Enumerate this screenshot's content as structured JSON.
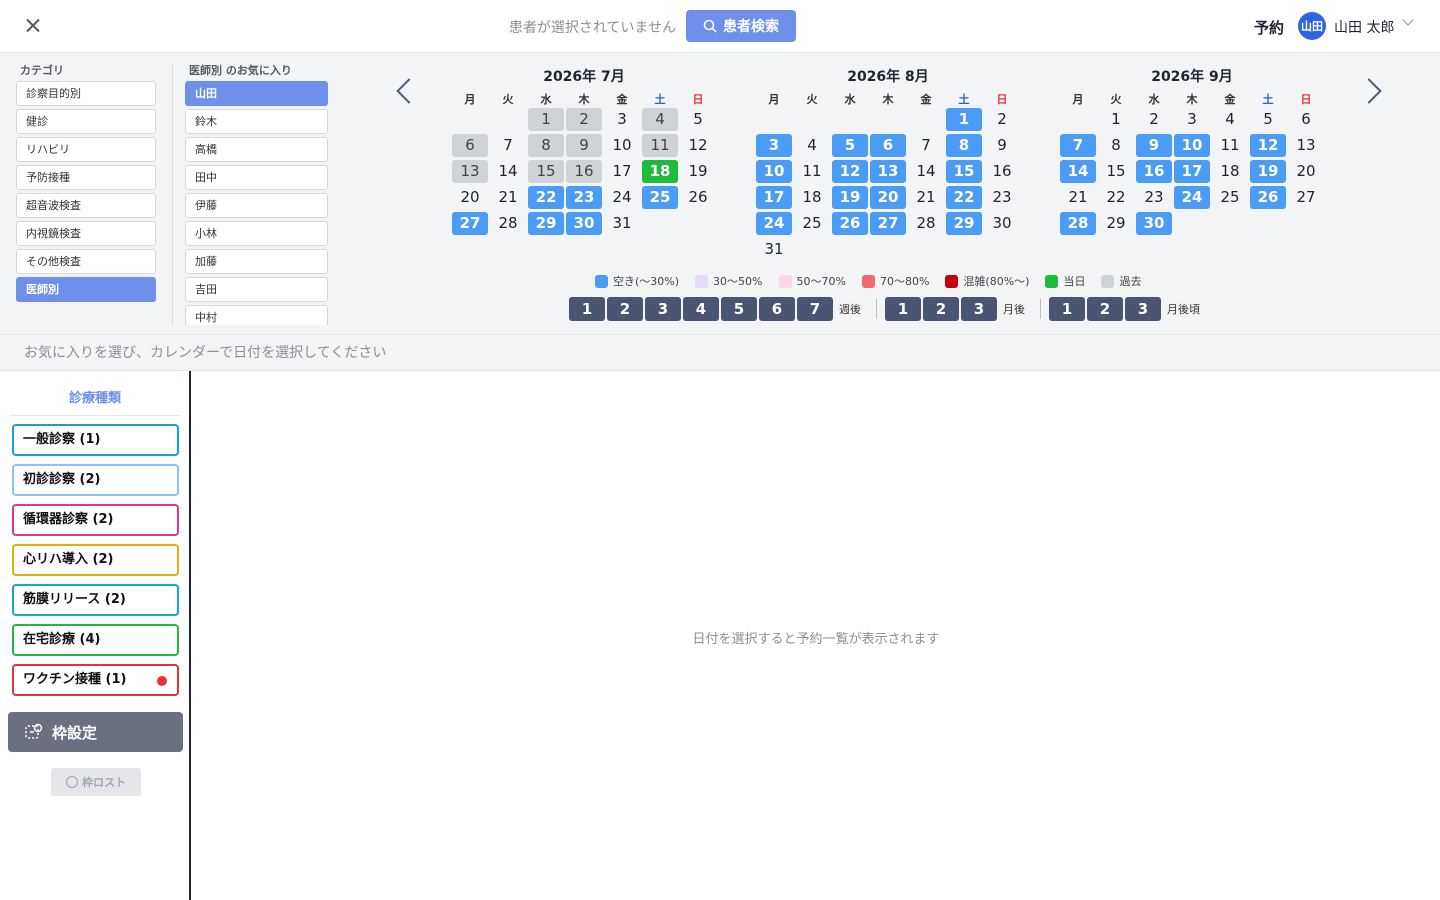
{
  "header": {
    "no_patient_text": "患者が選択されていません",
    "search_button": "患者検索",
    "reservation_label": "予約",
    "avatar_text": "山田",
    "user_name": "山田 太郎"
  },
  "category": {
    "title": "カテゴリ",
    "items": [
      "診察目的別",
      "健診",
      "リハビリ",
      "予防接種",
      "超音波検査",
      "内視鏡検査",
      "その他検査",
      "医師別"
    ],
    "selected_index": 7
  },
  "favorites": {
    "title": "医師別 のお気に入り",
    "items": [
      "山田",
      "鈴木",
      "高橋",
      "田中",
      "伊藤",
      "小林",
      "加藤",
      "吉田",
      "中村"
    ],
    "selected_index": 0
  },
  "weekdays": [
    "月",
    "火",
    "水",
    "木",
    "金",
    "土",
    "日"
  ],
  "months": [
    {
      "title": "2026年 7月",
      "first_weekday": 2,
      "days": 31,
      "past": [
        1,
        2,
        4,
        6,
        8,
        9,
        11,
        13,
        15,
        16
      ],
      "available": [
        22,
        23,
        25,
        27,
        29,
        30
      ],
      "today": 18
    },
    {
      "title": "2026年 8月",
      "first_weekday": 5,
      "days": 31,
      "past": [],
      "available": [
        1,
        3,
        5,
        6,
        8,
        10,
        12,
        13,
        15,
        17,
        19,
        20,
        22,
        24,
        26,
        27,
        29
      ],
      "today": null
    },
    {
      "title": "2026年 9月",
      "first_weekday": 1,
      "days": 30,
      "past": [],
      "available": [
        7,
        9,
        10,
        12,
        14,
        16,
        17,
        19,
        24,
        26,
        28,
        30
      ],
      "today": null
    }
  ],
  "legend": [
    {
      "label": "空き(〜30%)",
      "color": "#4a9cf5"
    },
    {
      "label": "30〜50%",
      "color": "#e6d9fb"
    },
    {
      "label": "50〜70%",
      "color": "#fbd5e8"
    },
    {
      "label": "70〜80%",
      "color": "#f46a6a"
    },
    {
      "label": "混雑(80%〜)",
      "color": "#c40010"
    },
    {
      "label": "当日",
      "color": "#1dba3c"
    },
    {
      "label": "過去",
      "color": "#cfd2d7"
    }
  ],
  "jump_groups": [
    {
      "numbers": [
        "1",
        "2",
        "3",
        "4",
        "5",
        "6",
        "7"
      ],
      "label": "週後"
    },
    {
      "numbers": [
        "1",
        "2",
        "3"
      ],
      "label": "月後"
    },
    {
      "numbers": [
        "1",
        "2",
        "3"
      ],
      "label": "月後頃"
    }
  ],
  "hint_text": "お気に入りを選び、カレンダーで日付を選択してください",
  "types": {
    "title": "診療種類",
    "items": [
      {
        "label": "一般診察 (1)",
        "color": "#1a9fd6",
        "dot": false
      },
      {
        "label": "初診診察 (2)",
        "color": "#8cc2f5",
        "dot": false
      },
      {
        "label": "循環器診察 (2)",
        "color": "#e0368f",
        "dot": false
      },
      {
        "label": "心リハ導入 (2)",
        "color": "#e6ad12",
        "dot": false
      },
      {
        "label": "筋膜リリース (2)",
        "color": "#18a8c0",
        "dot": false
      },
      {
        "label": "在宅診療 (4)",
        "color": "#1dba4a",
        "dot": false
      },
      {
        "label": "ワクチン接種 (1)",
        "color": "#e5313a",
        "dot": true
      }
    ]
  },
  "frame_button": "枠設定",
  "lost_button": "枠ロスト",
  "empty_message": "日付を選択すると予約一覧が表示されます"
}
